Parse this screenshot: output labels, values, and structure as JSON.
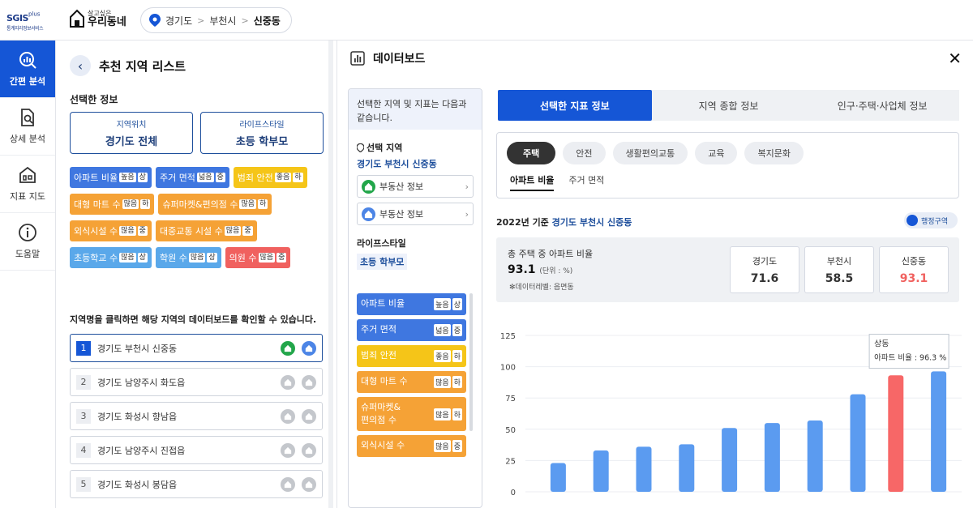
{
  "header": {
    "sgis_name": "SGIS",
    "sgis_plus": "plus",
    "sgis_sub": "통계지리정보서비스",
    "brand_small": "살고싶은",
    "brand_big": "우리동네",
    "breadcrumb": [
      "경기도",
      "부천시",
      "신중동"
    ]
  },
  "sidenav": [
    {
      "label": "간편 분석",
      "icon": "chart-search-icon",
      "active": true
    },
    {
      "label": "상세 분석",
      "icon": "document-search-icon",
      "active": false
    },
    {
      "label": "지표 지도",
      "icon": "house-map-icon",
      "active": false
    },
    {
      "label": "도움말",
      "icon": "info-icon",
      "active": false
    }
  ],
  "left_panel": {
    "title": "추천 지역 리스트",
    "selected_section": "선택한 정보",
    "location_label": "지역위치",
    "location_value": "경기도 전체",
    "lifestyle_label": "라이프스타일",
    "lifestyle_value": "초등 학부모",
    "tags": [
      {
        "label": "아파트 비율",
        "chips": [
          "높음",
          "상"
        ],
        "color": "blue"
      },
      {
        "label": "주거 면적",
        "chips": [
          "넓음",
          "중"
        ],
        "color": "blue"
      },
      {
        "label": "범죄 안전",
        "chips": [
          "좋음",
          "하"
        ],
        "color": "yellow"
      },
      {
        "label": "대형 마트 수",
        "chips": [
          "많음",
          "하"
        ],
        "color": "orange"
      },
      {
        "label": "슈퍼마켓&편의점 수",
        "chips": [
          "많음",
          "하"
        ],
        "color": "orange"
      },
      {
        "label": "외식시설 수",
        "chips": [
          "많음",
          "중"
        ],
        "color": "orange"
      },
      {
        "label": "대중교통 시설 수",
        "chips": [
          "많음",
          "중"
        ],
        "color": "orange"
      },
      {
        "label": "초등학교 수",
        "chips": [
          "많음",
          "상"
        ],
        "color": "sky"
      },
      {
        "label": "학원 수",
        "chips": [
          "많음",
          "상"
        ],
        "color": "sky"
      },
      {
        "label": "의원 수",
        "chips": [
          "많음",
          "중"
        ],
        "color": "red"
      }
    ],
    "note": "지역명을 클릭하면 해당 지역의 데이터보드를 확인할 수 있습니다.",
    "regions": [
      {
        "num": "1",
        "name": "경기도 부천시 신중동",
        "active": true
      },
      {
        "num": "2",
        "name": "경기도 남양주시 화도읍",
        "active": false
      },
      {
        "num": "3",
        "name": "경기도 화성시 향남읍",
        "active": false
      },
      {
        "num": "4",
        "name": "경기도 남양주시 진접읍",
        "active": false
      },
      {
        "num": "5",
        "name": "경기도 화성시 봉담읍",
        "active": false
      }
    ]
  },
  "dashboard": {
    "title": "데이터보드",
    "close": "✕",
    "info_intro": "선택한 지역 및 지표는 다음과 같습니다.",
    "region_label": "선택 지역",
    "region_value": "경기도 부천시 신중동",
    "buttons": [
      "부동산 정보",
      "부동산 정보"
    ],
    "lifestyle_label": "라이프스타일",
    "lifestyle_value": "초등 학부모",
    "metrics": [
      {
        "label": "아파트 비율",
        "chips": [
          "높음",
          "상"
        ],
        "color": "blue"
      },
      {
        "label": "주거 면적",
        "chips": [
          "넓음",
          "중"
        ],
        "color": "blue"
      },
      {
        "label": "범죄 안전",
        "chips": [
          "좋음",
          "하"
        ],
        "color": "yellow"
      },
      {
        "label": "대형 마트 수",
        "chips": [
          "많음",
          "하"
        ],
        "color": "orange"
      },
      {
        "label": "슈퍼마켓&\n편의점 수",
        "chips": [
          "많음",
          "하"
        ],
        "color": "orange"
      },
      {
        "label": "외식시설 수",
        "chips": [
          "많음",
          "중"
        ],
        "color": "orange"
      }
    ],
    "tabs": [
      "선택한 지표 정보",
      "지역 종합 정보",
      "인구·주택·사업체 정보"
    ],
    "categories": [
      "주택",
      "안전",
      "생활편의교통",
      "교육",
      "복지문화"
    ],
    "subtabs": [
      "아파트 비율",
      "주거 면적"
    ],
    "year_prefix": "2022년 기준",
    "year_region": "경기도 부천시 신중동",
    "admin_toggle": "행정구역",
    "summary_label": "총 주택 중 아파트 비율",
    "summary_value": "93.1",
    "summary_unit": "(단위 : %)",
    "summary_note": "✻데이터레벨: 읍면동",
    "compare": [
      {
        "name": "경기도",
        "value": "71.6",
        "highlight": false
      },
      {
        "name": "부천시",
        "value": "58.5",
        "highlight": false
      },
      {
        "name": "신중동",
        "value": "93.1",
        "highlight": true
      }
    ]
  },
  "colors": {
    "primary": "#1556d6",
    "bar": "#5b9bf0",
    "highlight": "#f76767",
    "blue": "#3f77e0",
    "yellow": "#f5c518",
    "orange": "#f5a236",
    "sky": "#5aa8ea",
    "red": "#f0615f"
  },
  "chart_data": {
    "type": "bar",
    "ylim": [
      0,
      125
    ],
    "yticks": [
      0,
      25,
      50,
      75,
      100,
      125
    ],
    "values": [
      23,
      33,
      36,
      38,
      51,
      55,
      57,
      78,
      93.1,
      96.3
    ],
    "highlight_index": 8,
    "tooltip_index": 9,
    "tooltip_title": "상동",
    "tooltip_text": "아파트 비율 : 96.3 %"
  }
}
